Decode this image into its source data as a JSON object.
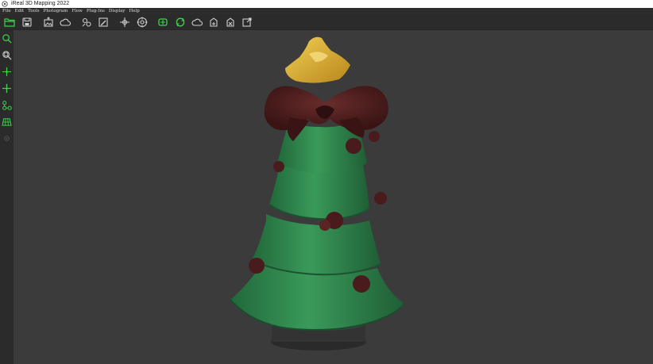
{
  "window": {
    "title": "iReal 3D Mapping 2022"
  },
  "menu": [
    "File",
    "Edit",
    "Tools",
    "Photogram",
    "Flow",
    "Plug-Ins",
    "Display",
    "Help"
  ],
  "toolbar_icons": [
    "open-folder-icon",
    "save-icon",
    "import-image-icon",
    "cloud-icon",
    "photo-align-icon",
    "edit-icon",
    "point-tool-icon",
    "target-icon",
    "mesh-icon",
    "texture-icon",
    "cloud-icon",
    "transform-icon",
    "transform-icon",
    "transform-icon",
    "export-icon"
  ],
  "left_tools": [
    "zoom-icon",
    "zoom-fit-icon",
    "move-icon",
    "move-icon",
    "connect-icon",
    "grid-icon",
    "settings-icon"
  ],
  "colors": {
    "accent": "#3fd24a",
    "background": "#3b3b3b",
    "panel": "#2b2b2b",
    "tree_green": "#2e8b4f",
    "bow_brown": "#4a1b1c",
    "star_gold": "#d8a928",
    "base_black": "#333333"
  }
}
